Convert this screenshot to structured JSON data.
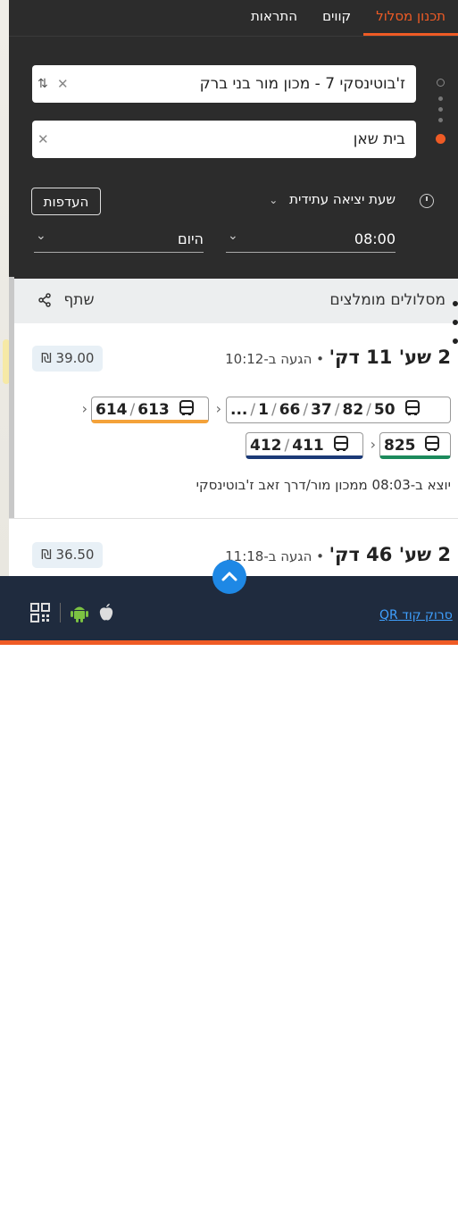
{
  "tabs": [
    {
      "label": "תכנון מסלול",
      "active": true
    },
    {
      "label": "קווים",
      "active": false
    },
    {
      "label": "התראות",
      "active": false
    }
  ],
  "search": {
    "origin_value": "ז'בוטינסקי 7 - מכון מור בני ברק",
    "destination_value": "בית שאן"
  },
  "departure": {
    "label": "שעת יציאה עתידית",
    "prefs_label": "העדפות",
    "time_value": "08:00",
    "day_value": "היום"
  },
  "results": {
    "title": "מסלולים מומלצים",
    "share_label": "שתף"
  },
  "routes": [
    {
      "duration": "2 שע' 11 דק'",
      "arrival": "• הגעה ב-10:12",
      "price": "₪ 39.00",
      "chips": {
        "c1": {
          "n1": "50",
          "n2": "82",
          "n3": "37",
          "n4": "66",
          "n5": "1",
          "n6": "..."
        },
        "c2": {
          "n1": "613",
          "n2": "614"
        },
        "c3": {
          "n1": "825"
        },
        "c4": {
          "n1": "411",
          "n2": "412"
        }
      },
      "leave": "יוצא ב-08:03 ממכון מור/דרך זאב ז'בוטינסקי"
    },
    {
      "duration": "2 שע' 46 דק'",
      "arrival": "• הגעה ב-11:18",
      "price": "₪ 36.50"
    }
  ],
  "footer": {
    "qr_link": "סרוק קוד QR"
  },
  "colors": {
    "accent": "#ef5b25",
    "dark_panel": "#2c2c2c",
    "footer": "#1f2b3e",
    "scroll_up_button": "#1e88e5",
    "line_orange": "#f4a23a",
    "line_green": "#1c8a5c",
    "line_navy": "#1b3a77"
  }
}
